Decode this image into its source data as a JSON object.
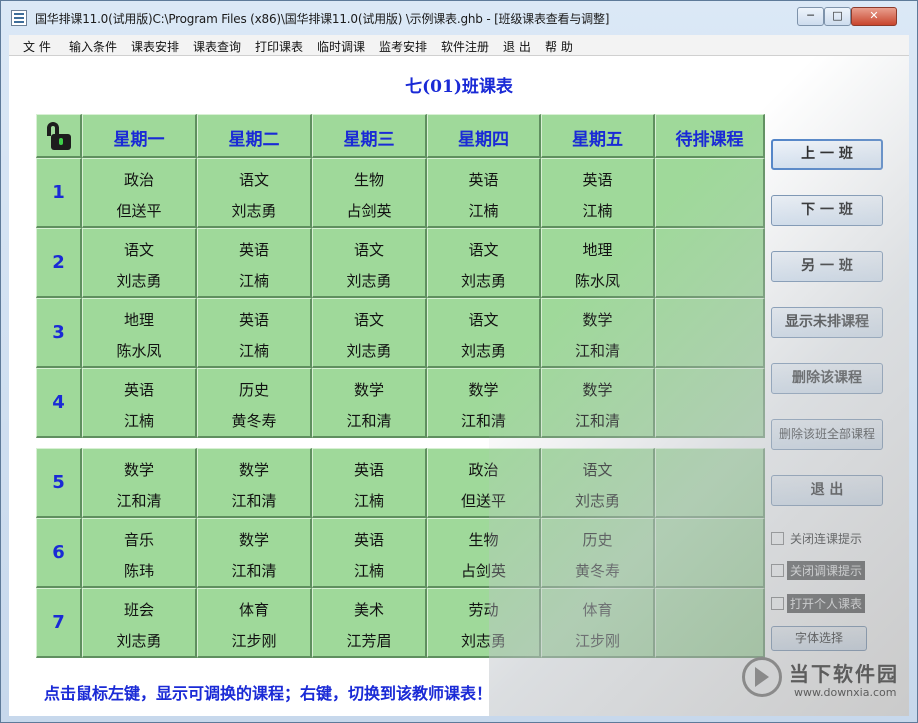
{
  "window": {
    "title": "国华排课11.0(试用版)C:\\Program Files (x86)\\国华排课11.0(试用版) \\示例课表.ghb - [班级课表查看与调整]",
    "controls": [
      "─",
      "□",
      "✕"
    ]
  },
  "menu": [
    "文 件",
    "输入条件",
    "课表安排",
    "课表查询",
    "打印课表",
    "临时调课",
    "监考安排",
    "软件注册",
    "退 出",
    "帮 助"
  ],
  "class_title": "七(01)班课表",
  "headers": [
    "星期一",
    "星期二",
    "星期三",
    "星期四",
    "星期五",
    "待排课程"
  ],
  "periods": [
    "1",
    "2",
    "3",
    "4",
    "5",
    "6",
    "7"
  ],
  "schedule": [
    [
      [
        "政治",
        "但送平"
      ],
      [
        "语文",
        "刘志勇"
      ],
      [
        "生物",
        "占剑英"
      ],
      [
        "英语",
        "江楠"
      ],
      [
        "英语",
        "江楠"
      ],
      [
        "",
        ""
      ]
    ],
    [
      [
        "语文",
        "刘志勇"
      ],
      [
        "英语",
        "江楠"
      ],
      [
        "语文",
        "刘志勇"
      ],
      [
        "语文",
        "刘志勇"
      ],
      [
        "地理",
        "陈水凤"
      ],
      [
        "",
        ""
      ]
    ],
    [
      [
        "地理",
        "陈水凤"
      ],
      [
        "英语",
        "江楠"
      ],
      [
        "语文",
        "刘志勇"
      ],
      [
        "语文",
        "刘志勇"
      ],
      [
        "数学",
        "江和清"
      ],
      [
        "",
        ""
      ]
    ],
    [
      [
        "英语",
        "江楠"
      ],
      [
        "历史",
        "黄冬寿"
      ],
      [
        "数学",
        "江和清"
      ],
      [
        "数学",
        "江和清"
      ],
      [
        "数学",
        "江和清"
      ],
      [
        "",
        ""
      ]
    ],
    [
      [
        "数学",
        "江和清"
      ],
      [
        "数学",
        "江和清"
      ],
      [
        "英语",
        "江楠"
      ],
      [
        "政治",
        "但送平"
      ],
      [
        "语文",
        "刘志勇"
      ],
      [
        "",
        ""
      ]
    ],
    [
      [
        "音乐",
        "陈玮"
      ],
      [
        "数学",
        "江和清"
      ],
      [
        "英语",
        "江楠"
      ],
      [
        "生物",
        "占剑英"
      ],
      [
        "历史",
        "黄冬寿"
      ],
      [
        "",
        ""
      ]
    ],
    [
      [
        "班会",
        "刘志勇"
      ],
      [
        "体育",
        "江步刚"
      ],
      [
        "美术",
        "江芳眉"
      ],
      [
        "劳动",
        "刘志勇"
      ],
      [
        "体育",
        "江步刚"
      ],
      [
        "",
        ""
      ]
    ]
  ],
  "side_buttons": {
    "prev_class": "上 一 班",
    "next_class": "下 一 班",
    "other_class": "另 一 班",
    "show_unscheduled": "显示未排课程",
    "delete_course": "删除该课程",
    "delete_all": "删除该班全部课程",
    "exit": "退    出"
  },
  "checkboxes": {
    "close_consecutive": "关闭连课提示",
    "close_adjust": "关闭调课提示",
    "open_personal": "打开个人课表"
  },
  "font_button": "字体选择",
  "hint": "点击鼠标左键，显示可调换的课程；右键，切换到该教师课表！",
  "watermark": {
    "name": "当下软件园",
    "url": "www.downxia.com"
  },
  "colors": {
    "cell_green": "#9fd99a",
    "accent_blue": "#1a2ad6"
  }
}
